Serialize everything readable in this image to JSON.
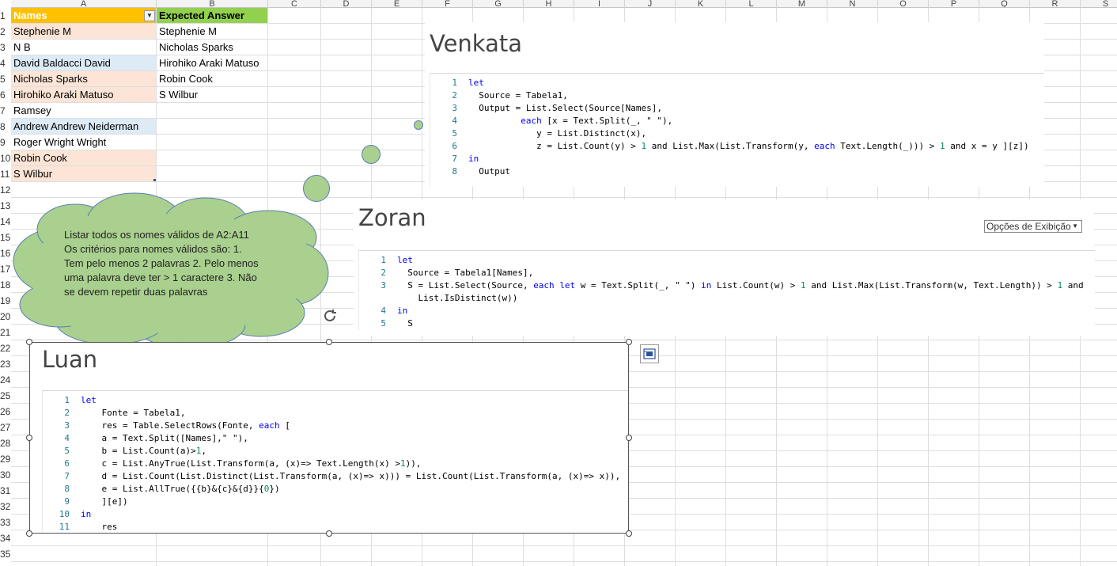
{
  "columns": [
    "A",
    "B",
    "C",
    "D",
    "E",
    "F",
    "G",
    "H",
    "I",
    "J",
    "K",
    "L",
    "M",
    "N",
    "O",
    "P",
    "Q",
    "R",
    "S"
  ],
  "rows": [
    "1",
    "2",
    "3",
    "4",
    "5",
    "6",
    "7",
    "8",
    "9",
    "10",
    "11",
    "12",
    "13",
    "14",
    "15",
    "16",
    "17",
    "18",
    "19",
    "20",
    "21",
    "22",
    "23",
    "24",
    "25",
    "26",
    "27",
    "28",
    "29",
    "30",
    "31",
    "32",
    "33",
    "34",
    "35"
  ],
  "table": {
    "header_names": "Names",
    "header_expected": "Expected Answer",
    "names": [
      "Stephenie M",
      "N B",
      "David Baldacci David",
      "Nicholas Sparks",
      "Hirohiko Araki Matuso",
      "Ramsey",
      "Andrew Andrew Neiderman",
      "Roger Wright Wright",
      "Robin Cook",
      "S Wilbur"
    ],
    "expected": [
      "Stephenie M",
      "Nicholas Sparks",
      "Hirohiko Araki Matuso",
      "Robin Cook",
      "S Wilbur"
    ]
  },
  "colors": {
    "names_header": "#ffc000",
    "expected_header": "#92d050",
    "peach": "#fce4d6",
    "blue": "#ddebf7",
    "cloud": "#a9d08e",
    "cloud_border": "#5b7db3",
    "keyword": "#0000ff",
    "number": "#098658",
    "line_number": "#237893"
  },
  "cloud": {
    "text": "Listar todos os nomes válidos de A2:A11  Os critérios para nomes válidos são: 1. Tem pelo menos 2 palavras 2. Pelo menos uma palavra deve ter > 1 caractere 3. Não se devem repetir duas palavras"
  },
  "panels": {
    "venkata": {
      "title": "Venkata",
      "lines": [
        "let",
        "  Source = Tabela1,",
        "  Output = List.Select(Source[Names],",
        "          each [x = Text.Split(_, \" \"),",
        "             y = List.Distinct(x),",
        "             z = List.Count(y) > 1 and List.Max(List.Transform(y, each Text.Length(_))) > 1 and x = y ][z])",
        "in",
        "  Output"
      ]
    },
    "zoran": {
      "title": "Zoran",
      "view_options": "Opções de Exibição",
      "lines": [
        "let",
        "  Source = Tabela1[Names],",
        "  S = List.Select(Source, each let w = Text.Split(_, \" \") in List.Count(w) > 1 and List.Max(List.Transform(w, Text.Length)) > 1 and",
        "    List.IsDistinct(w))",
        "in",
        "  S"
      ],
      "line_numbers": [
        "1",
        "2",
        "3",
        "",
        "4",
        "5"
      ]
    },
    "luan": {
      "title": "Luan",
      "lines": [
        "let",
        "    Fonte = Tabela1,",
        "    res = Table.SelectRows(Fonte, each [",
        "    a = Text.Split([Names],\" \"),",
        "    b = List.Count(a)>1,",
        "    c = List.AnyTrue(List.Transform(a, (x)=> Text.Length(x) >1)),",
        "    d = List.Count(List.Distinct(List.Transform(a, (x)=> x))) = List.Count(List.Transform(a, (x)=> x)),",
        "    e = List.AllTrue({{b}&{c}&{d}}{0})",
        "    ][e])",
        "in",
        "    res"
      ]
    }
  },
  "icons": {
    "rotate": "rotate-handle-icon",
    "layout": "layout-options-icon",
    "filter": "filter-dropdown-icon"
  }
}
